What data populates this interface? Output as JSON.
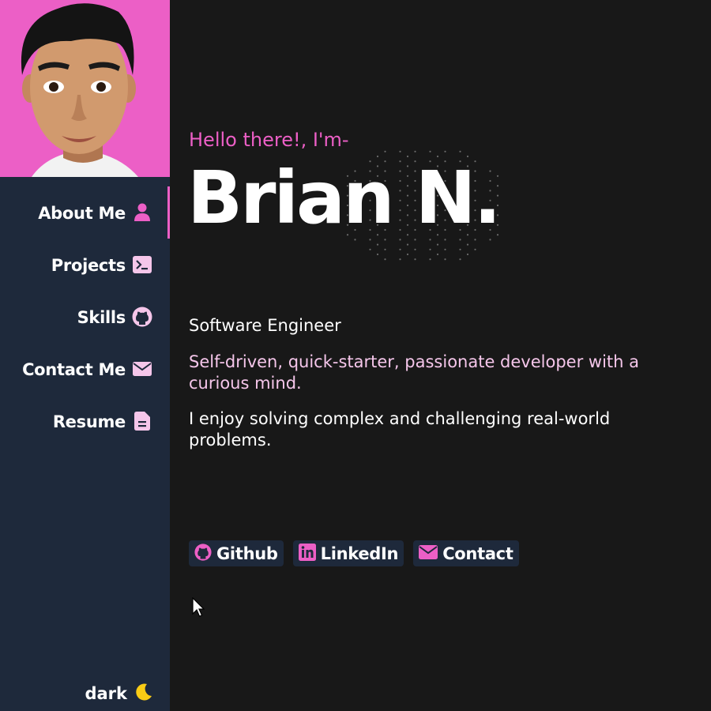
{
  "sidebar": {
    "avatar": {
      "alt": "Cartoon portrait avatar"
    },
    "items": [
      {
        "label": "About Me",
        "icon": "user-icon",
        "active": true
      },
      {
        "label": "Projects",
        "icon": "terminal-icon",
        "active": false
      },
      {
        "label": "Skills",
        "icon": "github-icon",
        "active": false
      },
      {
        "label": "Contact Me",
        "icon": "envelope-icon",
        "active": false
      },
      {
        "label": "Resume",
        "icon": "document-icon",
        "active": false
      }
    ],
    "theme": {
      "label": "dark",
      "icon": "moon-icon"
    }
  },
  "hero": {
    "greeting": "Hello there!, I'm-",
    "name": "Brian N.",
    "role": "Software Engineer",
    "tagline": "Self-driven, quick-starter, passionate developer with a curious mind.",
    "description": "I enjoy solving complex and challenging real-world problems."
  },
  "links": [
    {
      "label": "Github",
      "icon": "github-icon"
    },
    {
      "label": "LinkedIn",
      "icon": "linkedin-icon"
    },
    {
      "label": "Contact",
      "icon": "envelope-icon"
    }
  ],
  "colors": {
    "accent": "#ec5fc6",
    "sidebar_bg": "#1e293b",
    "main_bg": "#181818",
    "tagline": "#f5c6ea",
    "moon": "#facc15"
  }
}
